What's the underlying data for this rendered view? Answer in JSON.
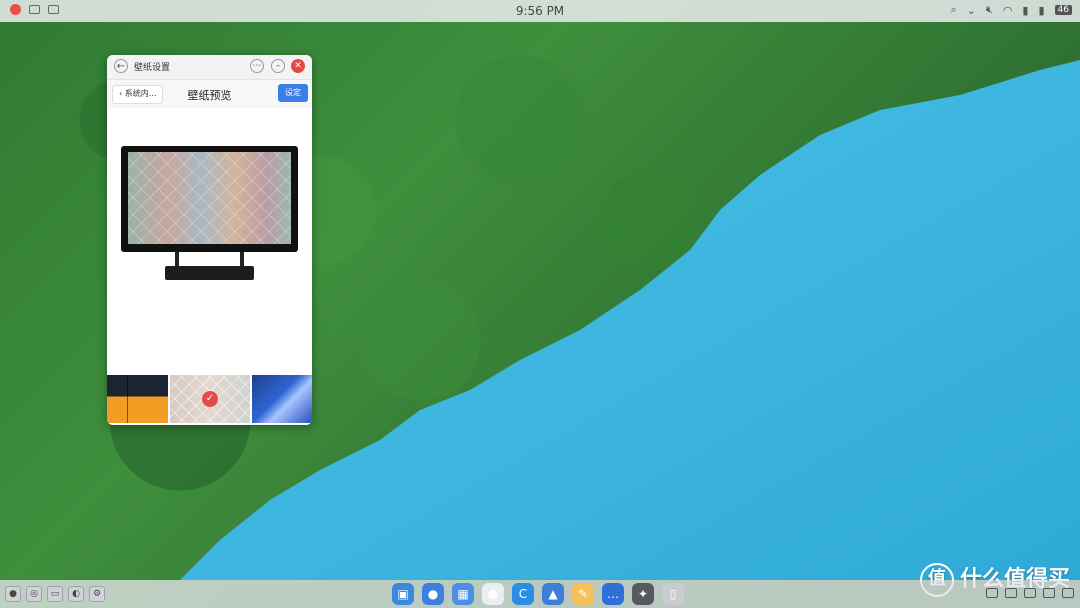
{
  "topbar": {
    "clock": "9:56 PM",
    "battery_label": "46",
    "icons": [
      "close-dot-icon",
      "screen-share-icon",
      "monitor-icon",
      "search-icon",
      "chevron-down-icon",
      "mute-icon",
      "wifi-icon",
      "signal-icon",
      "signal-icon-2",
      "battery-icon"
    ]
  },
  "window": {
    "title": "壁纸设置",
    "nav_back_label": "系统内...",
    "nav_title": "壁纸预览",
    "set_button_label": "设定",
    "more_label": "⋯",
    "min_label": "–",
    "close_label": "✕",
    "back_label": "←"
  },
  "thumbnails": [
    {
      "name": "thumb-orange-dark"
    },
    {
      "name": "thumb-pastel-tiles",
      "selected": true
    },
    {
      "name": "thumb-blue-abstract"
    }
  ],
  "colors": {
    "accent": "#3a7ee8",
    "close": "#e84545",
    "check": "#e34b4b",
    "lake": "#37b6e0",
    "forest": "#2f7a33"
  },
  "taskbar": {
    "dock": [
      {
        "name": "finder-icon",
        "color": "#3b88e0",
        "glyph": "▣"
      },
      {
        "name": "folder-icon",
        "color": "#3d7fdc",
        "glyph": "●"
      },
      {
        "name": "launcher-icon",
        "color": "#4d8fe3",
        "glyph": "▦"
      },
      {
        "name": "chat-icon",
        "color": "#e9eef3",
        "glyph": "●"
      },
      {
        "name": "refresh-icon",
        "color": "#2b8ee6",
        "glyph": "C"
      },
      {
        "name": "photos-icon",
        "color": "#3d7fd8",
        "glyph": "▲"
      },
      {
        "name": "notes-icon",
        "color": "#f6c15a",
        "glyph": "✎"
      },
      {
        "name": "message-icon",
        "color": "#2f6fd6",
        "glyph": "…"
      },
      {
        "name": "browser-icon",
        "color": "#565a60",
        "glyph": "✦"
      },
      {
        "name": "trash-icon",
        "color": "#c9ccd1",
        "glyph": "▯"
      }
    ]
  },
  "watermark": {
    "logo": "值",
    "text": "什么值得买"
  }
}
